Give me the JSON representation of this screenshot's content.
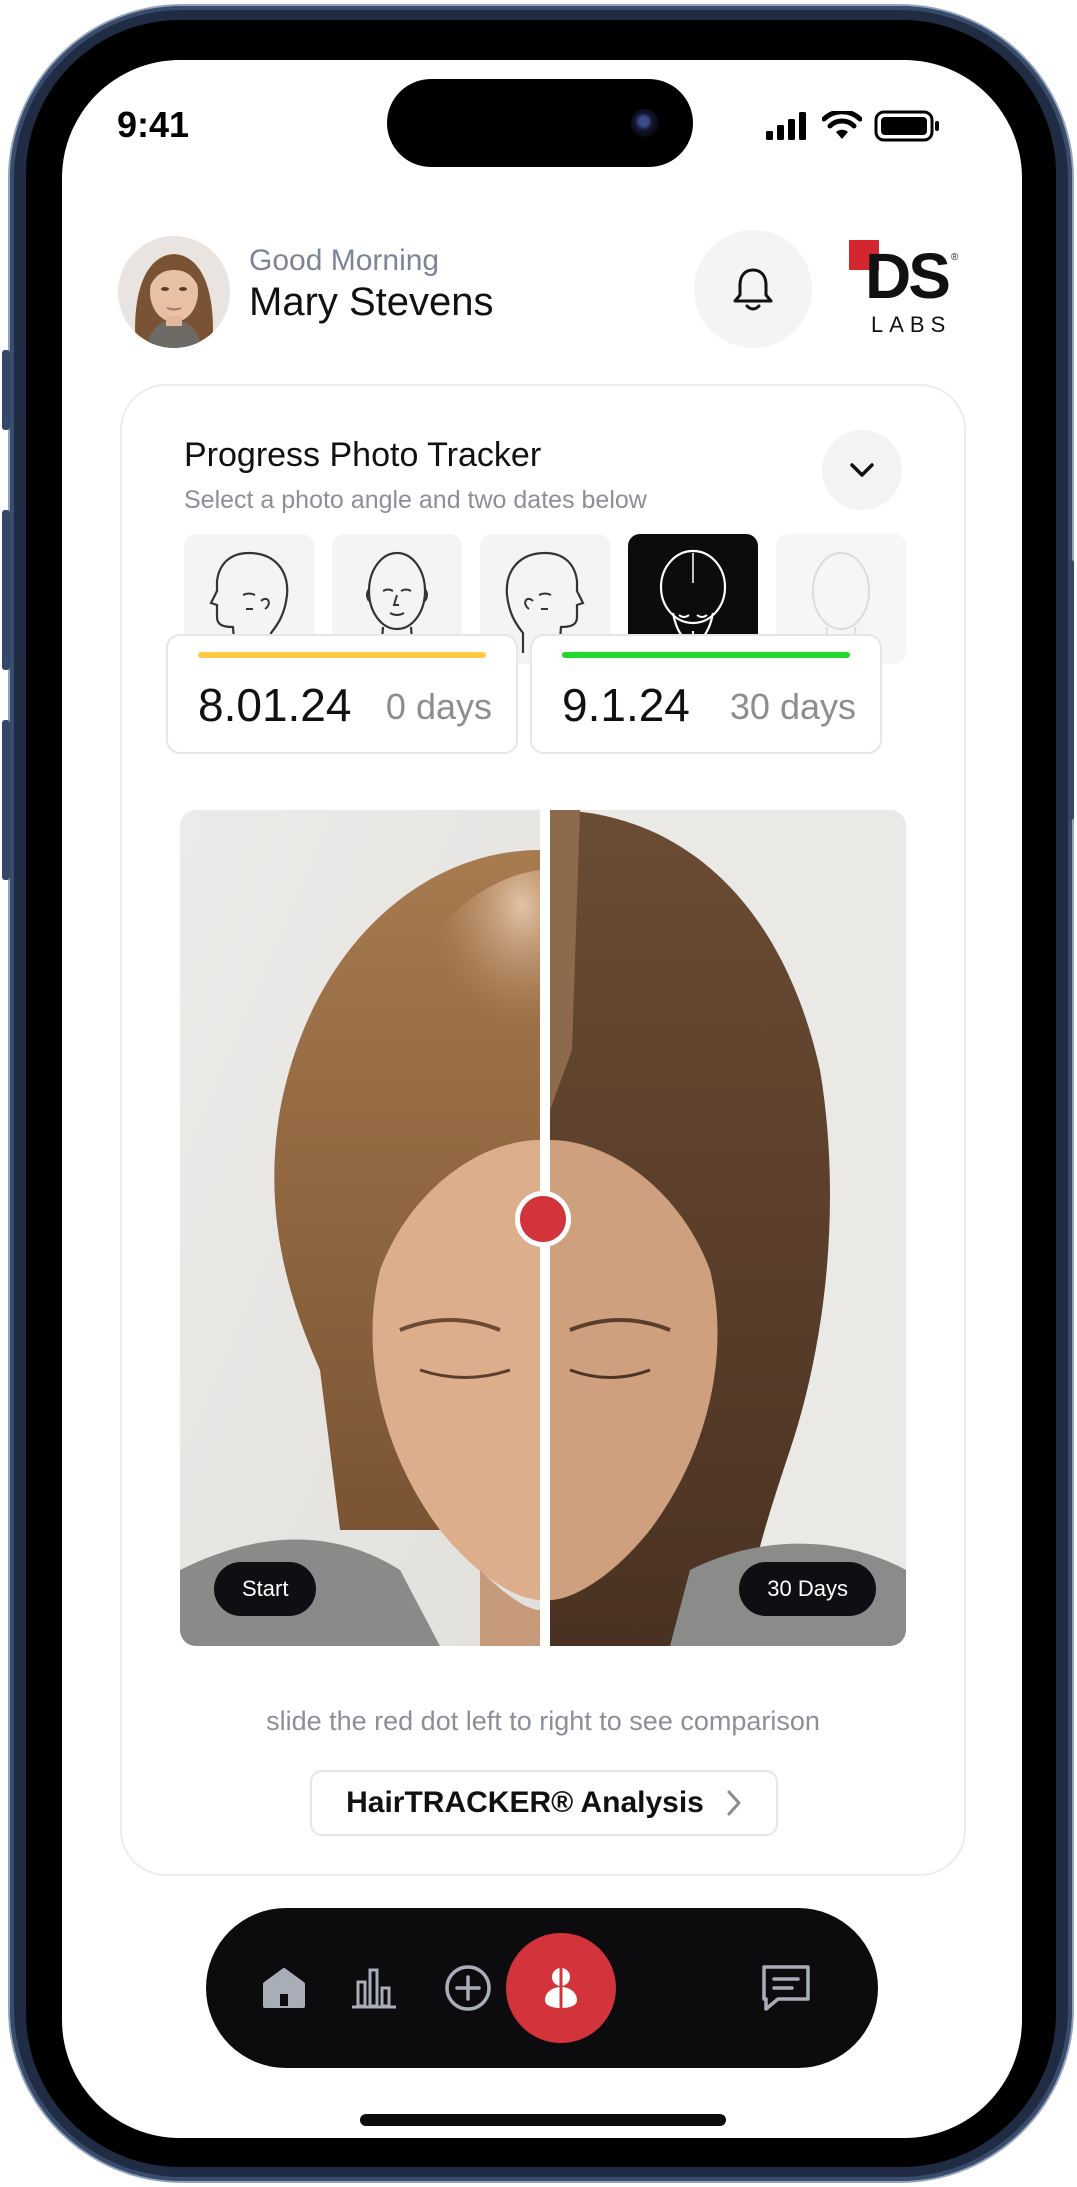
{
  "status_bar": {
    "time": "9:41"
  },
  "header": {
    "greeting": "Good Morning",
    "user_name": "Mary Stevens",
    "brand": {
      "ds": "DS",
      "labs": "LABS",
      "reg": "®"
    }
  },
  "tracker": {
    "title": "Progress Photo Tracker",
    "subtitle": "Select a photo angle and two dates below",
    "angles": [
      {
        "icon": "head-left-profile-icon",
        "state": "normal"
      },
      {
        "icon": "head-front-icon",
        "state": "normal"
      },
      {
        "icon": "head-right-profile-icon",
        "state": "normal"
      },
      {
        "icon": "head-top-icon",
        "state": "selected"
      },
      {
        "icon": "head-back-icon",
        "state": "disabled"
      }
    ],
    "dates": [
      {
        "date": "8.01.24",
        "days": "0 days",
        "color": "#ffc940"
      },
      {
        "date": "9.1.24",
        "days": "30 days",
        "color": "#22d82b"
      }
    ],
    "compare": {
      "left_label": "Start",
      "right_label": "30 Days"
    },
    "hint": "slide the red dot left to right to see comparison",
    "analysis_button": "HairTRACKER® Analysis"
  },
  "nav": {
    "items": [
      "home-icon",
      "stats-icon",
      "add-icon",
      "tracker-icon",
      "chat-icon"
    ],
    "active": "tracker-icon"
  },
  "colors": {
    "accent": "#d3333b",
    "yellow": "#ffc940",
    "green": "#22d82b"
  }
}
